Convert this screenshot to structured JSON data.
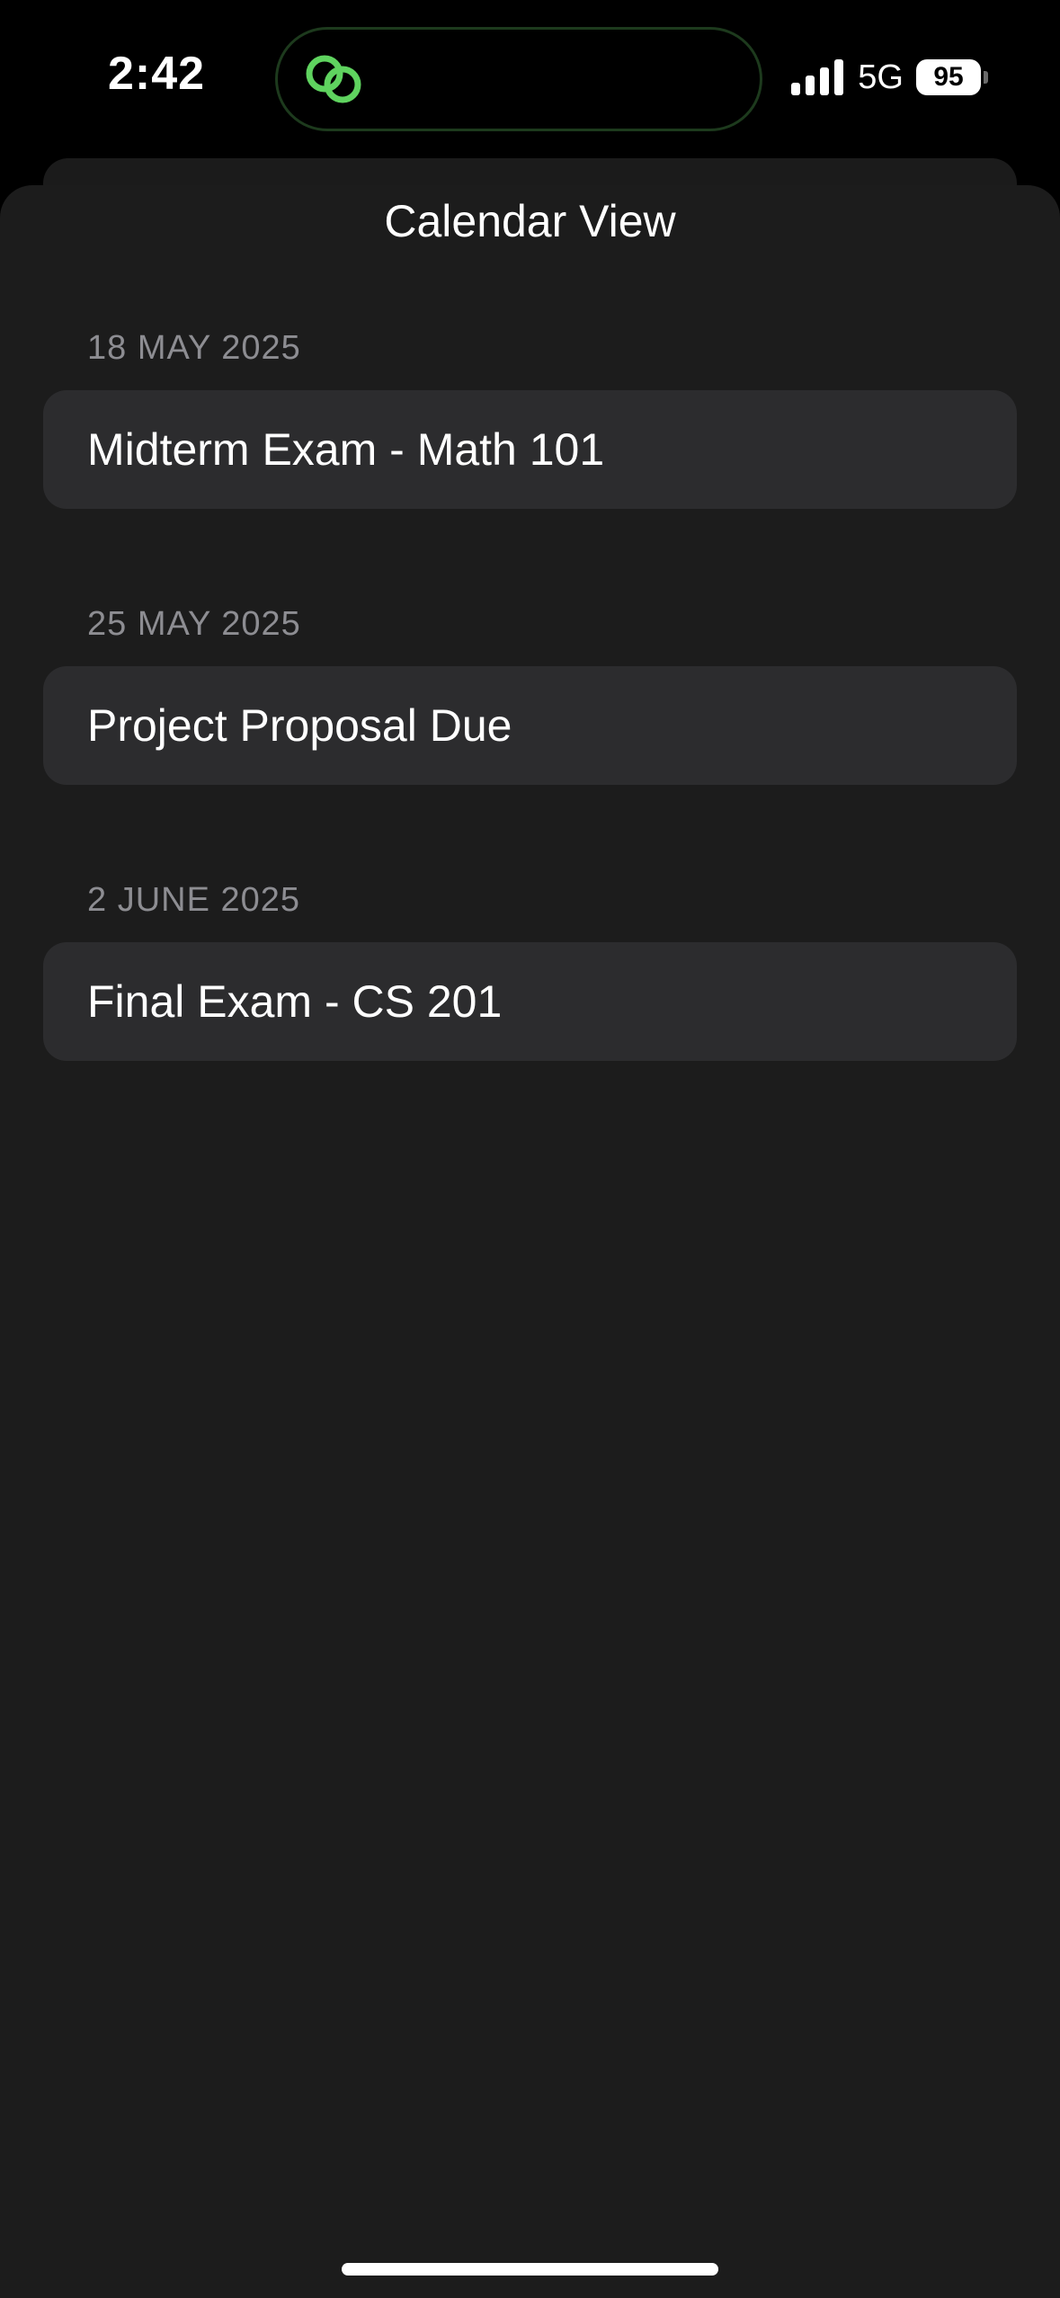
{
  "status_bar": {
    "time": "2:42",
    "network": "5G",
    "battery_level": "95",
    "island_icon": "link-rings-icon",
    "accent_color": "#5fd35f"
  },
  "sheet": {
    "title": "Calendar View",
    "sections": [
      {
        "date": "18 MAY 2025",
        "event": "Midterm Exam - Math 101"
      },
      {
        "date": "25 MAY 2025",
        "event": "Project Proposal Due"
      },
      {
        "date": "2 JUNE 2025",
        "event": "Final Exam - CS 201"
      }
    ]
  }
}
